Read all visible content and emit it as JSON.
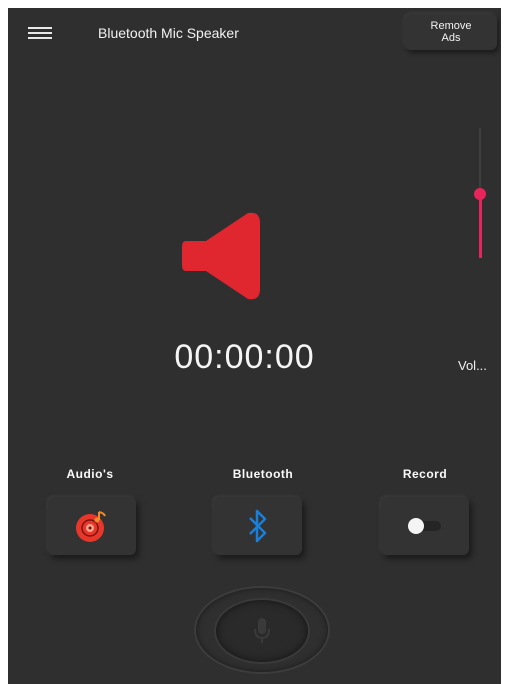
{
  "header": {
    "title": "Bluetooth Mic Speaker",
    "remove_ads_label": "Remove\nAds"
  },
  "icons": {
    "menu": "hamburger-menu-icon",
    "speaker": "speaker-icon",
    "audios": "music-disc-icon",
    "bluetooth": "bluetooth-icon",
    "record": "toggle-icon",
    "mic": "microphone-icon"
  },
  "player": {
    "timer": "00:00:00",
    "volume_label": "Vol...",
    "volume_level": 0.5
  },
  "controls": {
    "audios_label": "Audio's",
    "bluetooth_label": "Bluetooth",
    "record_label": "Record",
    "record_on": false
  },
  "colors": {
    "background": "#2f2f2f",
    "accent_red": "#e0262f",
    "slider_accent": "#e8245a",
    "bluetooth_blue": "#1a7fd6"
  }
}
